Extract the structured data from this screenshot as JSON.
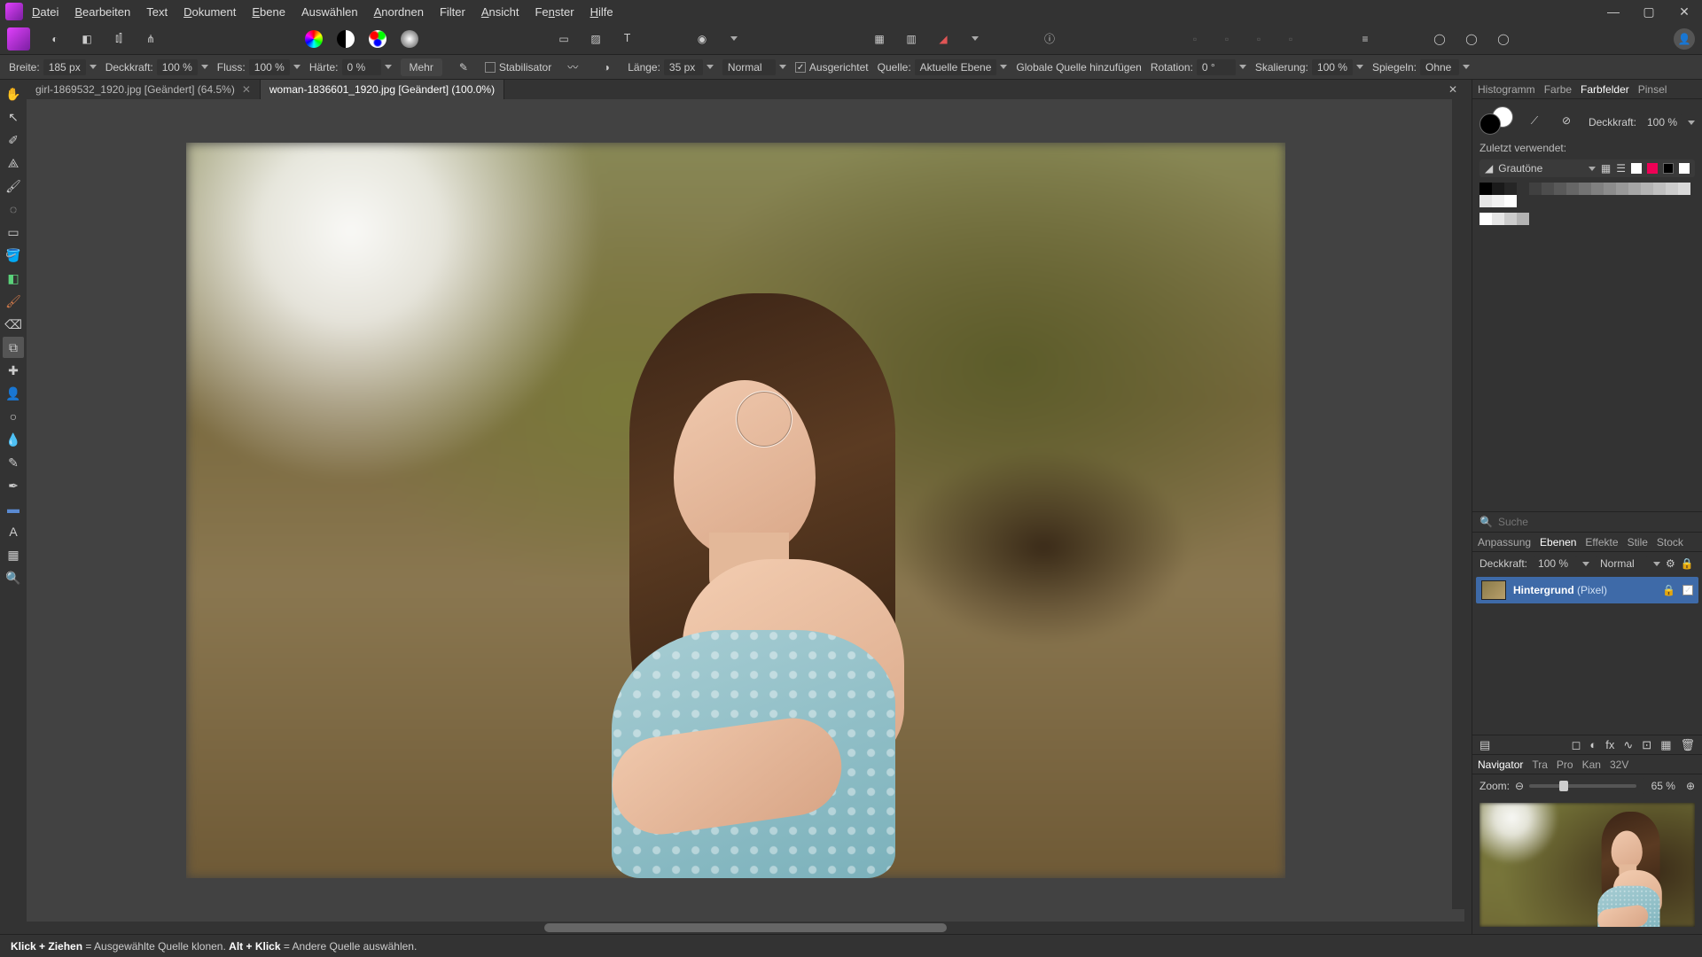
{
  "menu": [
    "Datei",
    "Bearbeiten",
    "Text",
    "Dokument",
    "Ebene",
    "Auswählen",
    "Anordnen",
    "Filter",
    "Ansicht",
    "Fenster",
    "Hilfe"
  ],
  "menu_underline_idx": [
    0,
    0,
    null,
    0,
    0,
    null,
    0,
    null,
    0,
    2,
    0
  ],
  "context": {
    "breite_lbl": "Breite:",
    "breite": "185 px",
    "deckkraft_lbl": "Deckkraft:",
    "deckkraft": "100 %",
    "fluss_lbl": "Fluss:",
    "fluss": "100 %",
    "haerte_lbl": "Härte:",
    "haerte": "0 %",
    "mehr": "Mehr",
    "stabil": "Stabilisator",
    "laenge_lbl": "Länge:",
    "laenge": "35 px",
    "mode": "Normal",
    "ausgerichtet": "Ausgerichtet",
    "quelle_lbl": "Quelle:",
    "quelle": "Aktuelle Ebene",
    "global": "Globale Quelle hinzufügen",
    "rotation_lbl": "Rotation:",
    "rotation": "0 °",
    "skal_lbl": "Skalierung:",
    "skal": "100 %",
    "spiegel_lbl": "Spiegeln:",
    "spiegel": "Ohne"
  },
  "tabs": [
    {
      "title": "girl-1869532_1920.jpg [Geändert] (64.5%)",
      "active": false
    },
    {
      "title": "woman-1836601_1920.jpg [Geändert] (100.0%)",
      "active": true
    }
  ],
  "right": {
    "top_tabs": [
      "Histogramm",
      "Farbe",
      "Farbfelder",
      "Pinsel"
    ],
    "top_active": "Farbfelder",
    "deckkraft_lbl": "Deckkraft:",
    "deckkraft": "100 %",
    "recent": "Zuletzt verwendet:",
    "palette": "Grautöne",
    "search_ph": "Suche",
    "mid_tabs": [
      "Anpassung",
      "Ebenen",
      "Effekte",
      "Stile",
      "Stock"
    ],
    "mid_active": "Ebenen",
    "layer_deck_lbl": "Deckkraft:",
    "layer_deck": "100 %",
    "layer_blend": "Normal",
    "layer_name": "Hintergrund",
    "layer_type": "(Pixel)",
    "nav_tabs": [
      "Navigator",
      "Tra",
      "Pro",
      "Kan",
      "32V"
    ],
    "nav_active": "Navigator",
    "zoom_lbl": "Zoom:",
    "zoom": "65 %"
  },
  "status": {
    "a": "Klick + Ziehen",
    "a2": " = Ausgewählte Quelle klonen. ",
    "b": "Alt + Klick",
    "b2": " = Andere Quelle auswählen."
  },
  "greys": [
    "#000000",
    "#1a1a1a",
    "#262626",
    "#333333",
    "#404040",
    "#4d4d4d",
    "#595959",
    "#666666",
    "#737373",
    "#808080",
    "#8c8c8c",
    "#999999",
    "#a6a6a6",
    "#b3b3b3",
    "#bfbfbf",
    "#cccccc",
    "#d9d9d9",
    "#e6e6e6",
    "#f2f2f2",
    "#ffffff"
  ],
  "greys2": [
    "#ffffff",
    "#e6e6e6",
    "#cccccc",
    "#b3b3b3"
  ]
}
